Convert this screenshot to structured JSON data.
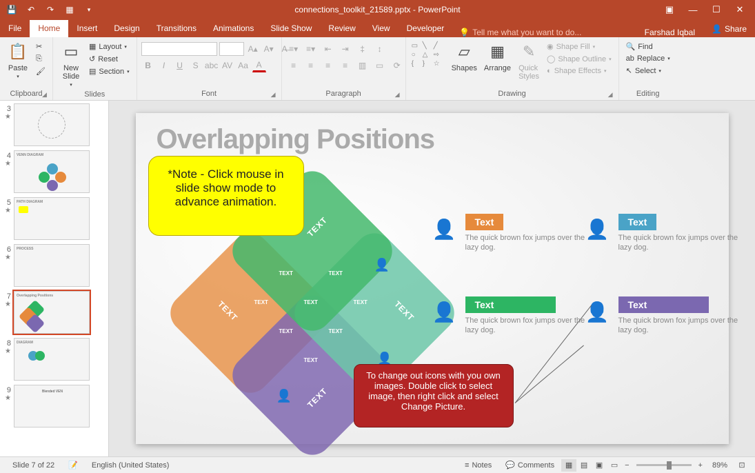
{
  "titlebar": {
    "filename": "connections_toolkit_21589.pptx - PowerPoint"
  },
  "menu": {
    "file": "File",
    "home": "Home",
    "insert": "Insert",
    "design": "Design",
    "transitions": "Transitions",
    "animations": "Animations",
    "slideshow": "Slide Show",
    "review": "Review",
    "view": "View",
    "developer": "Developer",
    "tellme": "Tell me what you want to do...",
    "user": "Farshad Iqbal",
    "share": "Share"
  },
  "ribbon": {
    "clipboard": {
      "paste": "Paste",
      "label": "Clipboard"
    },
    "slides": {
      "newslide": "New\nSlide",
      "layout": "Layout",
      "reset": "Reset",
      "section": "Section",
      "label": "Slides"
    },
    "font": {
      "name": "",
      "size": "",
      "label": "Font"
    },
    "paragraph": {
      "label": "Paragraph"
    },
    "drawing": {
      "shapes": "Shapes",
      "arrange": "Arrange",
      "quickstyles": "Quick\nStyles",
      "shapefill": "Shape Fill",
      "shapeoutline": "Shape Outline",
      "shapeeffects": "Shape Effects",
      "label": "Drawing"
    },
    "editing": {
      "find": "Find",
      "replace": "Replace",
      "select": "Select",
      "label": "Editing"
    }
  },
  "thumbs": [
    {
      "num": "3",
      "title": ""
    },
    {
      "num": "4",
      "title": "VENN DIAGRAM"
    },
    {
      "num": "5",
      "title": "PATH DIAGRAM"
    },
    {
      "num": "6",
      "title": "PROCESS"
    },
    {
      "num": "7",
      "title": "Overlapping Positions"
    },
    {
      "num": "8",
      "title": "DIAGRAM"
    },
    {
      "num": "9",
      "title": "Blended VEN"
    }
  ],
  "slide": {
    "title": "Overlapping Positions",
    "note_yellow": "*Note -  Click mouse in slide show mode to advance animation.",
    "note_red": "To change out icons with you own images.  Double click to select image, then right click and select Change Picture.",
    "sq_text": "TEXT",
    "blocks": [
      {
        "tag": "Text",
        "desc": "The quick brown fox jumps over the lazy dog.",
        "color": "#e68a3c"
      },
      {
        "tag": "Text",
        "desc": "The quick brown fox jumps over the lazy dog.",
        "color": "#4aa3c7"
      },
      {
        "tag": "Text",
        "desc": "The quick brown fox jumps over the lazy dog.",
        "color": "#2db563"
      },
      {
        "tag": "Text",
        "desc": "The quick brown fox jumps over the lazy dog.",
        "color": "#7b68b0"
      }
    ]
  },
  "status": {
    "slideof": "Slide 7 of 22",
    "lang": "English (United States)",
    "notes": "Notes",
    "comments": "Comments",
    "zoom": "89%"
  }
}
